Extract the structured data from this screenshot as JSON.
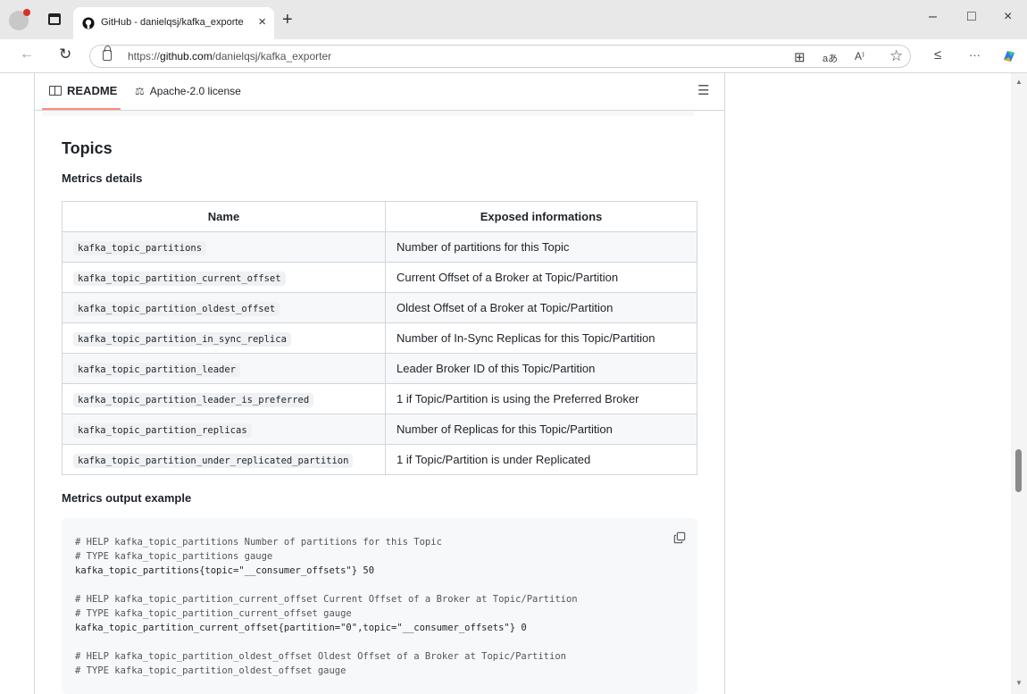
{
  "browser": {
    "tab_title": "GitHub - danielqsj/kafka_exporter",
    "new_tab": "+",
    "tab_close": "×",
    "url_prefix": "https://",
    "url_host": "github.com",
    "url_path": "/danielqsj/kafka_exporter",
    "window_controls": [
      "–",
      "□",
      "×"
    ],
    "address_icons": [
      "split-screen-icon",
      "translate-icon",
      "read-aloud-icon",
      "favorite-icon",
      "collections-icon",
      "more-icon",
      "copilot-icon"
    ],
    "translate_label": "aあ",
    "read_aloud_label": "A⁾",
    "more_label": "···"
  },
  "readme": {
    "tab_label": "README",
    "license_label": "Apache-2.0 license",
    "heading": "Topics",
    "metrics_details_heading": "Metrics details",
    "metrics_output_heading": "Metrics output example",
    "table": {
      "headers": [
        "Name",
        "Exposed informations"
      ],
      "rows": [
        [
          "kafka_topic_partitions",
          "Number of partitions for this Topic"
        ],
        [
          "kafka_topic_partition_current_offset",
          "Current Offset of a Broker at Topic/Partition"
        ],
        [
          "kafka_topic_partition_oldest_offset",
          "Oldest Offset of a Broker at Topic/Partition"
        ],
        [
          "kafka_topic_partition_in_sync_replica",
          "Number of In-Sync Replicas for this Topic/Partition"
        ],
        [
          "kafka_topic_partition_leader",
          "Leader Broker ID of this Topic/Partition"
        ],
        [
          "kafka_topic_partition_leader_is_preferred",
          "1 if Topic/Partition is using the Preferred Broker"
        ],
        [
          "kafka_topic_partition_replicas",
          "Number of Replicas for this Topic/Partition"
        ],
        [
          "kafka_topic_partition_under_replicated_partition",
          "1 if Topic/Partition is under Replicated"
        ]
      ]
    },
    "code_lines": [
      "# HELP kafka_topic_partitions Number of partitions for this Topic",
      "# TYPE kafka_topic_partitions gauge",
      "kafka_topic_partitions{topic=\"__consumer_offsets\"} 50",
      "",
      "# HELP kafka_topic_partition_current_offset Current Offset of a Broker at Topic/Partition",
      "# TYPE kafka_topic_partition_current_offset gauge",
      "kafka_topic_partition_current_offset{partition=\"0\",topic=\"__consumer_offsets\"} 0",
      "",
      "# HELP kafka_topic_partition_oldest_offset Oldest Offset of a Broker at Topic/Partition",
      "# TYPE kafka_topic_partition_oldest_offset gauge"
    ]
  }
}
